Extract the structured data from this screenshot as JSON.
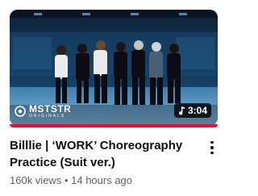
{
  "video": {
    "title": "Billlie | ‘WORK’ Choreography Practice (Suit ver.)",
    "views": "160k views",
    "separator": "•",
    "uploaded": "14 hours ago",
    "duration": "3:04",
    "channel_logo_text": "MSTSTR",
    "channel_logo_subtext": "ORIGINALS",
    "watch_progress_fraction": 1.0
  },
  "icons": {
    "duration": "music-note-icon",
    "more": "more-vertical-icon"
  },
  "colors": {
    "progress": "#ff0033",
    "title": "#0f0f0f",
    "meta": "#606060",
    "duration_bg": "#000000"
  }
}
